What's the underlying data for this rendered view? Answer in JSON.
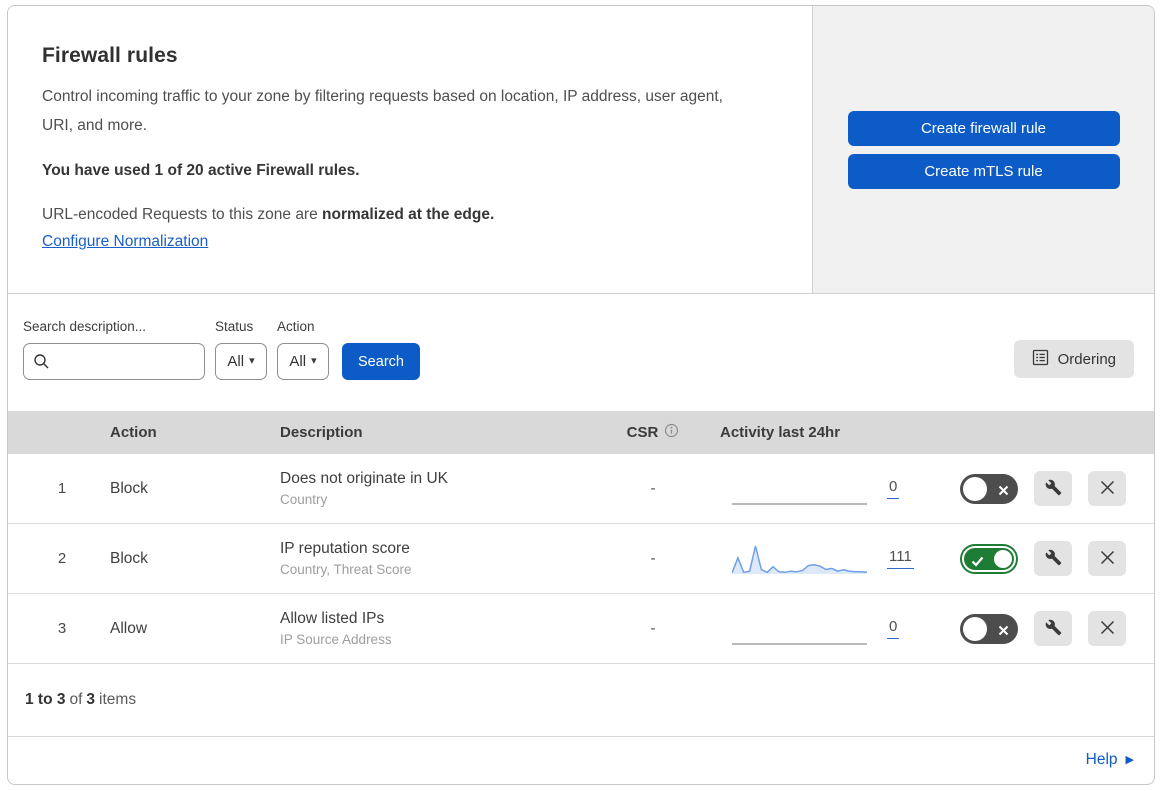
{
  "page": {
    "title": "Firewall rules",
    "description": "Control incoming traffic to your zone by filtering requests based on location, IP address, user agent, URI, and more.",
    "usage_note": "You have used 1 of 20 active Firewall rules.",
    "normalization_prefix": "URL-encoded Requests to this zone are ",
    "normalization_bold": "normalized at the edge.",
    "normalization_link": "Configure Normalization"
  },
  "actions_panel": {
    "create_firewall_rule_label": "Create firewall rule",
    "create_mtls_rule_label": "Create mTLS rule"
  },
  "filters": {
    "search_label": "Search description...",
    "search_value": "",
    "status_label": "Status",
    "status_value": "All",
    "action_label": "Action",
    "action_value": "All",
    "search_button_label": "Search",
    "ordering_button_label": "Ordering"
  },
  "table": {
    "headers": {
      "action": "Action",
      "description": "Description",
      "csr": "CSR",
      "activity": "Activity last 24hr"
    },
    "rows": [
      {
        "priority": "1",
        "action": "Block",
        "description": "Does not originate in UK",
        "fields": "Country",
        "csr": "-",
        "activity_count": "0",
        "enabled": false,
        "sparkline": [
          0,
          0,
          0,
          0,
          0,
          0,
          0,
          0,
          0,
          0,
          0,
          0
        ]
      },
      {
        "priority": "2",
        "action": "Block",
        "description": "IP reputation score",
        "fields": "Country, Threat Score",
        "csr": "-",
        "activity_count": "111",
        "enabled": true,
        "sparkline": [
          4,
          58,
          6,
          10,
          100,
          16,
          6,
          26,
          8,
          6,
          10,
          8,
          12,
          30,
          33,
          28,
          16,
          20,
          10,
          15,
          10,
          8,
          8,
          6
        ]
      },
      {
        "priority": "3",
        "action": "Allow",
        "description": "Allow listed IPs",
        "fields": "IP Source Address",
        "csr": "-",
        "activity_count": "0",
        "enabled": false,
        "sparkline": [
          0,
          0,
          0,
          0,
          0,
          0,
          0,
          0,
          0,
          0,
          0,
          0
        ]
      }
    ],
    "footer": {
      "range_bold": "1 to 3",
      "of_text": "of",
      "total_bold": "3",
      "items_text": "items"
    }
  },
  "help": {
    "label": "Help"
  },
  "colors": {
    "accent_blue": "#0d5bc6",
    "link_blue": "#1a5fc8",
    "toggle_on_green": "#1e7c35",
    "toggle_off_gray": "#4d4d4d",
    "table_header_bg": "#d9d9d9",
    "panel_bg": "#f1f1f1",
    "spark_line": "#6f9fe8",
    "spark_fill": "#dde8f9",
    "spark_flat": "#a3a3a3"
  }
}
